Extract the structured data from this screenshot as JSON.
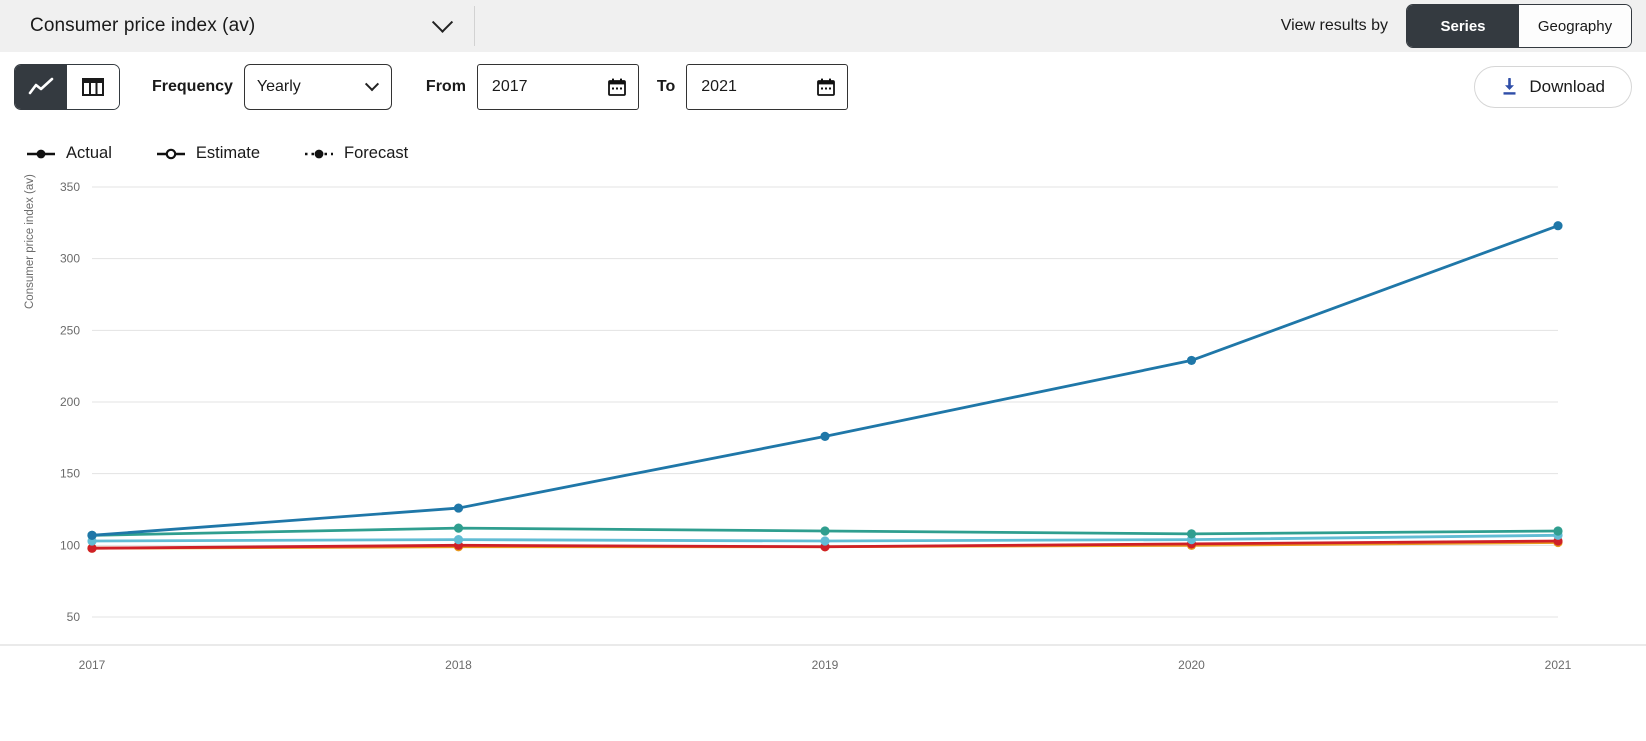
{
  "header": {
    "series_title": "Consumer price index (av)",
    "dropdown_icon": "chevron-down-icon",
    "view_results_by_label": "View results by",
    "toggle": {
      "options": [
        "Series",
        "Geography"
      ],
      "selected": "Series",
      "series_label": "Series",
      "geography_label": "Geography"
    }
  },
  "toolbar": {
    "view_toggle": {
      "chart_icon": "line-chart-icon",
      "table_icon": "table-icon",
      "selected": "chart"
    },
    "frequency_label": "Frequency",
    "frequency_value": "Yearly",
    "frequency_options": [
      "Yearly"
    ],
    "from_label": "From",
    "from_value": "2017",
    "from_placeholder": "From",
    "to_label": "To",
    "to_value": "2021",
    "to_placeholder": "To",
    "calendar_icon": "calendar-icon",
    "download_label": "Download",
    "download_icon": "download-icon",
    "download_icon_color": "#2f4ea8"
  },
  "legend": [
    {
      "label": "Actual",
      "style": "solid-filled-dot"
    },
    {
      "label": "Estimate",
      "style": "solid-hollow-dot"
    },
    {
      "label": "Forecast",
      "style": "dotted-filled-dot"
    }
  ],
  "chart_data": {
    "type": "line",
    "title": "",
    "xlabel": "",
    "ylabel": "Consumer price index (av)",
    "categories": [
      "2017",
      "2018",
      "2019",
      "2020",
      "2021"
    ],
    "x_ticks": [
      "2017",
      "2018",
      "2019",
      "2020",
      "2021"
    ],
    "y_ticks": [
      50,
      100,
      150,
      200,
      250,
      300,
      350
    ],
    "ylim": [
      50,
      350
    ],
    "grid": "horizontal",
    "legend_position": "top-left",
    "series": [
      {
        "name": "series-1",
        "color": "#1f77a8",
        "values": [
          107,
          126,
          176,
          229,
          323
        ]
      },
      {
        "name": "series-2",
        "color": "#2f9e8f",
        "values": [
          107,
          112,
          110,
          108,
          110
        ]
      },
      {
        "name": "series-3",
        "color": "#61bcd4",
        "values": [
          103,
          104,
          103,
          104,
          107
        ]
      },
      {
        "name": "series-4",
        "color": "#cf2027",
        "values": [
          98,
          100,
          99,
          101,
          103
        ]
      },
      {
        "name": "series-5",
        "color": "#e8991f",
        "values": [
          98,
          99,
          99,
          100,
          102
        ]
      }
    ]
  }
}
